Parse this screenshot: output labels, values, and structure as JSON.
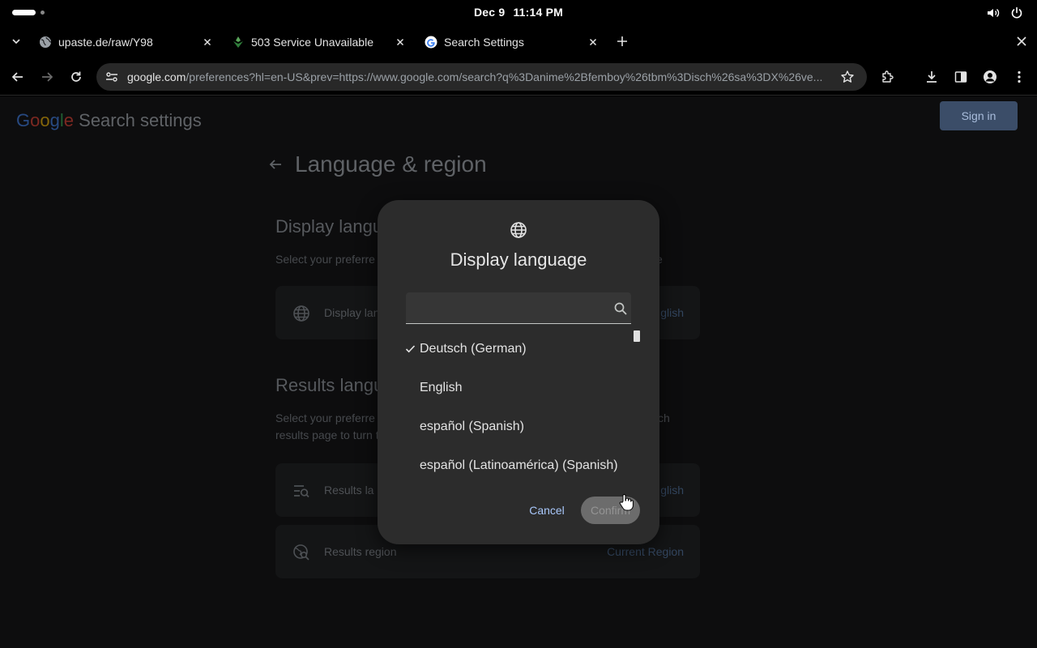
{
  "system_bar": {
    "date": "Dec 9",
    "time": "11:14 PM",
    "icons": [
      "activities-pill-icon",
      "volume-icon",
      "power-icon"
    ]
  },
  "tabs": [
    {
      "title": "upaste.de/raw/Y98",
      "favicon": "globe-icon",
      "active": false
    },
    {
      "title": "503 Service Unavailable",
      "favicon": "service-favicon-icon",
      "active": false
    },
    {
      "title": "Search Settings",
      "favicon": "google-g-icon",
      "active": true
    }
  ],
  "toolbar": {
    "url_host": "google.com",
    "url_path": "/preferences?hl=en-US&prev=https://www.google.com/search?q%3Danime%2Bfemboy%26tbm%3Disch%26sa%3DX%26ve...",
    "icons": [
      "back-icon",
      "forward-icon",
      "reload-icon",
      "site-settings-icon",
      "bookmark-star-icon",
      "extensions-icon",
      "download-icon",
      "side-panel-icon",
      "profile-icon",
      "menu-icon"
    ]
  },
  "page": {
    "brand_google": "Google",
    "brand_suffix": "Search settings",
    "sign_in": "Sign in",
    "heading": "Language & region",
    "display_section_title": "Display langu",
    "display_section_sub": "Select your preferre",
    "display_section_sub_tail": "e",
    "display_card_label": "Display lan",
    "display_card_value": "glish",
    "results_section_title": "Results langu",
    "results_section_sub_1": "Select your preferre",
    "results_section_sub_2": "results page to turn t",
    "results_section_sub_tail": "ch",
    "results_lang_card_label": "Results la",
    "results_lang_card_value": "glish",
    "results_region_label": "Results region",
    "results_region_value": "Current Region"
  },
  "dialog": {
    "title": "Display language",
    "search_placeholder": "",
    "options": [
      {
        "label": "Deutsch  (German)",
        "selected": true
      },
      {
        "label": "English",
        "selected": false
      },
      {
        "label": "español  (Spanish)",
        "selected": false
      },
      {
        "label": "español (Latinoamérica)  (Spanish)",
        "selected": false
      }
    ],
    "cancel_label": "Cancel",
    "confirm_label": "Confirm"
  },
  "colors": {
    "accent_blue": "#a8c7fa",
    "dialog_bg": "#2c2c2c",
    "scrim_page_bg": "#0d0d0e",
    "google_blue": "#4285f4",
    "google_red": "#ea4335",
    "google_yellow": "#fbbc05",
    "google_green": "#34a853"
  }
}
